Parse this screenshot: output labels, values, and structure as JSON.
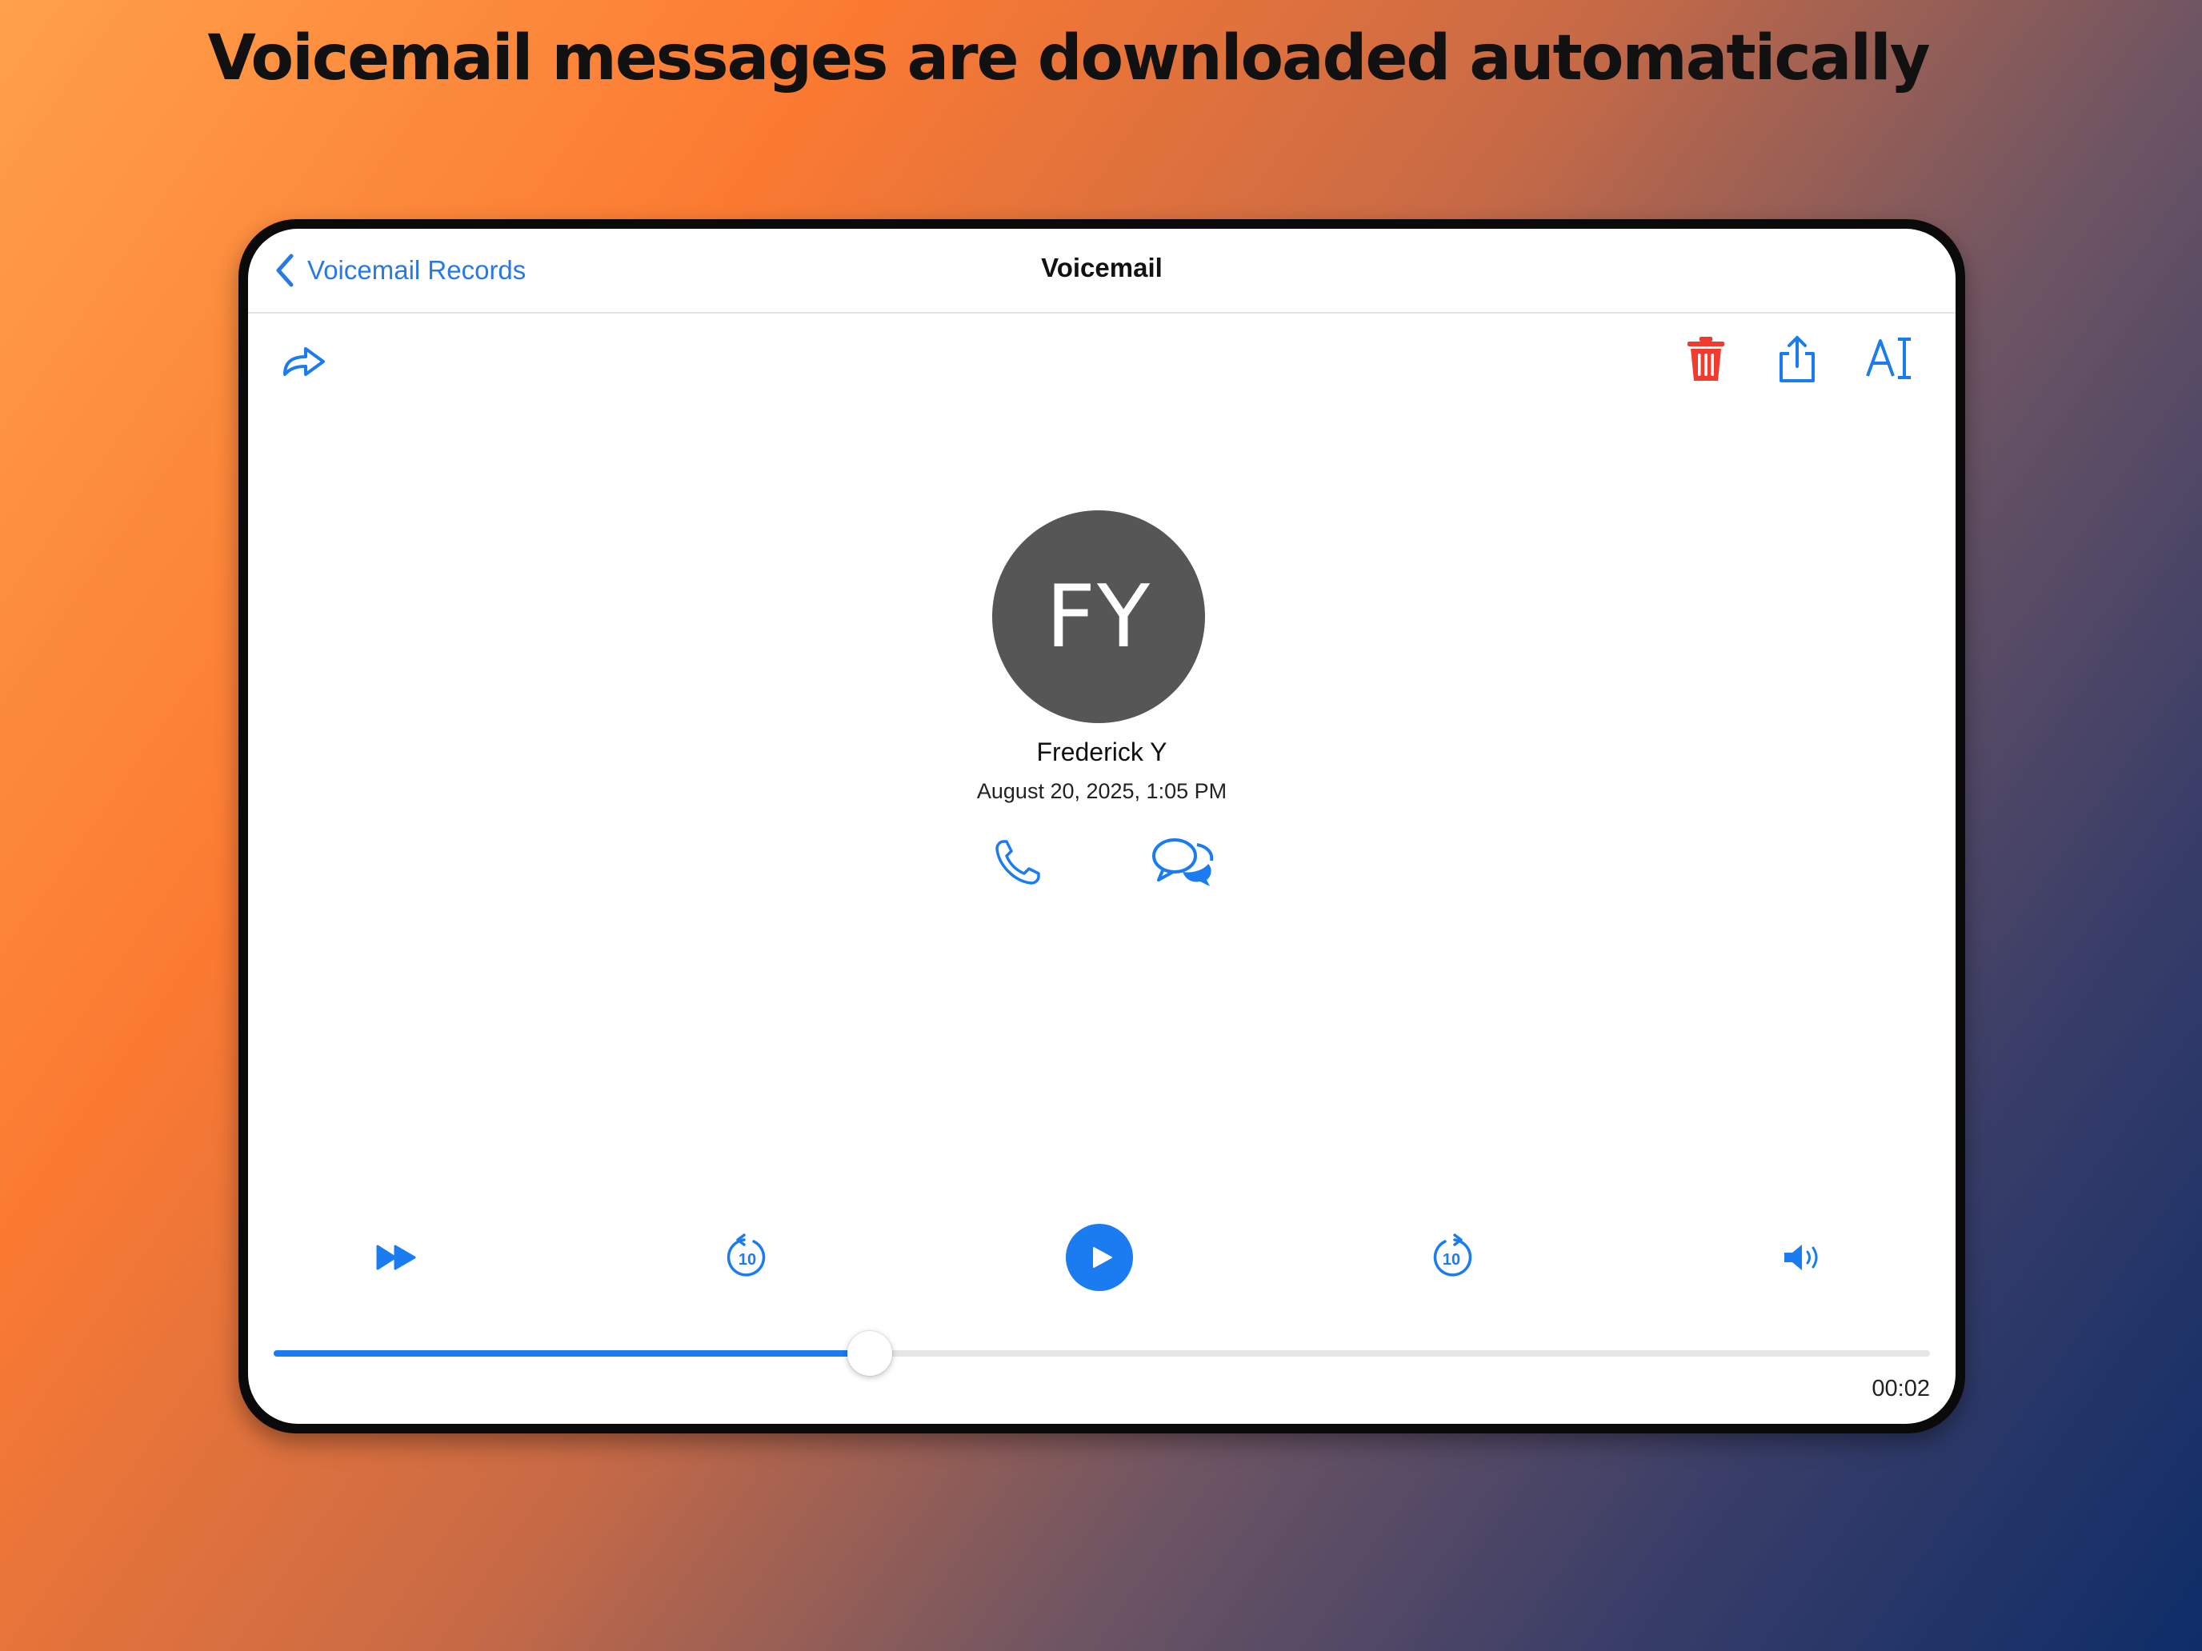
{
  "headline": "Voicemail messages are downloaded automatically",
  "navbar": {
    "back_label": "Voicemail Records",
    "title": "Voicemail"
  },
  "toolbar": {
    "left": [
      {
        "icon": "forward-icon"
      }
    ],
    "right": [
      {
        "icon": "trash-icon",
        "color": "#f23b2f"
      },
      {
        "icon": "share-icon"
      },
      {
        "icon": "text-transcribe-icon"
      }
    ]
  },
  "contact": {
    "initials": "FY",
    "name": "Frederick Y",
    "datetime": "August 20, 2025, 1:05 PM",
    "actions": [
      {
        "icon": "phone-icon"
      },
      {
        "icon": "chat-bubbles-icon"
      }
    ]
  },
  "player": {
    "controls": [
      {
        "icon": "fast-forward-icon"
      },
      {
        "icon": "rewind-10-icon"
      },
      {
        "icon": "play-icon"
      },
      {
        "icon": "skip-forward-10-icon"
      },
      {
        "icon": "volume-icon"
      }
    ],
    "progress": 0.36,
    "time": "00:02"
  },
  "colors": {
    "accent": "#1a7cf0",
    "destructive": "#f23b2f",
    "avatar_bg": "#565656"
  }
}
